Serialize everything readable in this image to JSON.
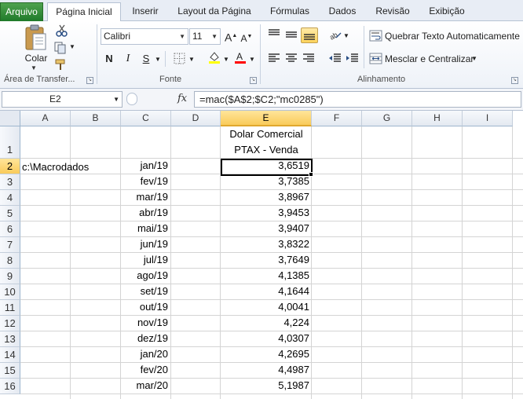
{
  "tabs": [
    {
      "label": "Arquivo"
    },
    {
      "label": "Página Inicial"
    },
    {
      "label": "Inserir"
    },
    {
      "label": "Layout da Página"
    },
    {
      "label": "Fórmulas"
    },
    {
      "label": "Dados"
    },
    {
      "label": "Revisão"
    },
    {
      "label": "Exibição"
    }
  ],
  "ribbon": {
    "clipboard": {
      "paste_label": "Colar",
      "group_label": "Área de Transfer..."
    },
    "font": {
      "name": "Calibri",
      "size": "11",
      "bold": "N",
      "italic": "I",
      "underline": "S",
      "group_label": "Fonte",
      "fill_color": "#ffff00",
      "font_color": "#ff0000"
    },
    "alignment": {
      "wrap_text": "Quebrar Texto Automaticamente",
      "merge_center": "Mesclar e Centralizar",
      "group_label": "Alinhamento"
    }
  },
  "formula_bar": {
    "name_box": "E2",
    "fx": "fx",
    "formula": "=mac($A$2;$C2;\"mc0285\")"
  },
  "grid": {
    "columns": [
      "A",
      "B",
      "C",
      "D",
      "E",
      "F",
      "G",
      "H",
      "I"
    ],
    "rows": [
      "1",
      "2",
      "3",
      "4",
      "5",
      "6",
      "7",
      "8",
      "9",
      "10",
      "11",
      "12",
      "13",
      "14",
      "15",
      "16"
    ],
    "selected_cell": "E2",
    "header_line1": "Dolar Comercial",
    "header_line2": "PTAX - Venda",
    "a2": "c:\\Macrodados",
    "dates": [
      "jan/19",
      "fev/19",
      "mar/19",
      "abr/19",
      "mai/19",
      "jun/19",
      "jul/19",
      "ago/19",
      "set/19",
      "out/19",
      "nov/19",
      "dez/19",
      "jan/20",
      "fev/20",
      "mar/20"
    ],
    "values": [
      "3,6519",
      "3,7385",
      "3,8967",
      "3,9453",
      "3,9407",
      "3,8322",
      "3,7649",
      "4,1385",
      "4,1644",
      "4,0041",
      "4,224",
      "4,0307",
      "4,2695",
      "4,4987",
      "5,1987"
    ]
  }
}
